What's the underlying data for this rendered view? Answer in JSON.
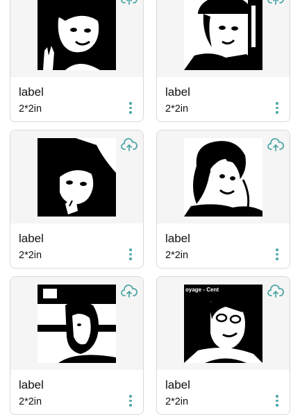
{
  "cards": [
    {
      "label": "label",
      "size": "2*2in"
    },
    {
      "label": "label",
      "size": "2*2in"
    },
    {
      "label": "label",
      "size": "2*2in"
    },
    {
      "label": "label",
      "size": "2*2in"
    },
    {
      "label": "label",
      "size": "2*2in"
    },
    {
      "label": "label",
      "size": "2*2in"
    }
  ],
  "photo_overlay_text": "oyage - Cent",
  "colors": {
    "accent": "#4fa6a6",
    "card_border": "#d9d9d9",
    "thumb_bg": "#f5f5f5"
  },
  "icons": {
    "upload": "cloud-upload-icon",
    "more": "more-vertical-icon"
  }
}
